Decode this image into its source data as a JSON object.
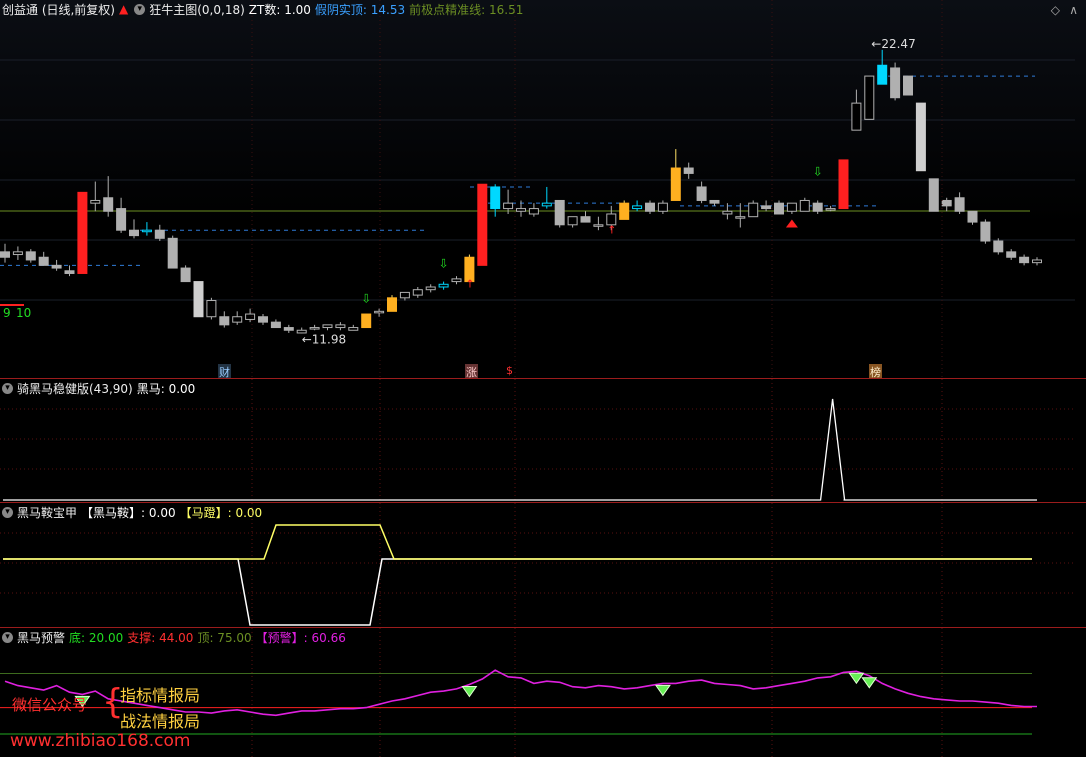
{
  "main_header": {
    "title": "创益通 (日线,前复权)",
    "indicator": "狂牛主图(0,0,18)",
    "zt_label": "ZT数: 1.00",
    "fake_label": "假阴实顶: 14.53",
    "prev_label": "前极点精准线: 16.51"
  },
  "main_annotations": {
    "high_label": "22.47",
    "low_label": "11.98",
    "count_a": "9",
    "count_b": "10",
    "tag_cai": "财",
    "tag_zhang": "涨",
    "tag_s": "$",
    "tag_bang": "榜"
  },
  "panel2_header": {
    "title": "骑黑马稳健版(43,90)",
    "value_label": "黑马: 0.00"
  },
  "panel3_header": {
    "title": "黑马鞍宝甲",
    "a_label": "【黑马鞍】: 0.00",
    "b_label": "【马蹬】: 0.00"
  },
  "panel4_header": {
    "title": "黑马预警",
    "d_label": "底: 20.00",
    "s_label": "支撑: 44.00",
    "t_label": "顶: 75.00",
    "w_label": "【预警】: 60.66"
  },
  "watermark": {
    "left": "微信公众号",
    "line1": "指标情报局",
    "line2": "战法情报局",
    "url": "www.zhibiao168.com"
  },
  "colors": {
    "up": "#ff2020",
    "down": "#00d8ff",
    "line_white": "#ffffff",
    "line_yellow": "#ffff66",
    "line_magenta": "#e020e0",
    "baseline_olive": "#6b8e23"
  },
  "chart_data": {
    "type": "candlestick",
    "ylim": [
      11.0,
      23.5
    ],
    "candles": [
      [
        15.0,
        15.3,
        14.6,
        14.8,
        "g"
      ],
      [
        14.9,
        15.2,
        14.7,
        15.0,
        "g"
      ],
      [
        15.0,
        15.1,
        14.6,
        14.7,
        "g"
      ],
      [
        14.8,
        15.0,
        14.5,
        14.5,
        "g"
      ],
      [
        14.5,
        14.7,
        14.3,
        14.4,
        "g"
      ],
      [
        14.3,
        14.5,
        14.1,
        14.2,
        "g"
      ],
      [
        14.2,
        17.2,
        14.2,
        17.2,
        "r"
      ],
      [
        16.8,
        17.6,
        16.5,
        16.9,
        "g"
      ],
      [
        17.0,
        17.8,
        16.3,
        16.5,
        "g"
      ],
      [
        16.6,
        17.0,
        15.7,
        15.8,
        "g"
      ],
      [
        15.8,
        16.2,
        15.5,
        15.6,
        "g"
      ],
      [
        15.8,
        16.1,
        15.6,
        15.8,
        "b"
      ],
      [
        15.8,
        16.0,
        15.4,
        15.5,
        "g"
      ],
      [
        15.5,
        15.6,
        14.4,
        14.4,
        "g"
      ],
      [
        14.4,
        14.5,
        13.9,
        13.9,
        "g"
      ],
      [
        13.9,
        13.9,
        12.6,
        12.6,
        "gg"
      ],
      [
        12.6,
        13.3,
        12.5,
        13.2,
        "g"
      ],
      [
        12.6,
        12.8,
        12.2,
        12.3,
        "g"
      ],
      [
        12.4,
        12.8,
        12.3,
        12.6,
        "g"
      ],
      [
        12.5,
        12.9,
        12.4,
        12.7,
        "g"
      ],
      [
        12.6,
        12.7,
        12.3,
        12.4,
        "g"
      ],
      [
        12.4,
        12.5,
        12.2,
        12.2,
        "g"
      ],
      [
        12.2,
        12.3,
        12.0,
        12.1,
        "g"
      ],
      [
        12.0,
        12.2,
        11.98,
        12.1,
        "g"
      ],
      [
        12.2,
        12.3,
        12.1,
        12.2,
        "g"
      ],
      [
        12.2,
        12.3,
        12.1,
        12.3,
        "g"
      ],
      [
        12.2,
        12.4,
        12.1,
        12.3,
        "g"
      ],
      [
        12.1,
        12.3,
        12.1,
        12.2,
        "g"
      ],
      [
        12.2,
        12.7,
        12.2,
        12.7,
        "o"
      ],
      [
        12.8,
        12.9,
        12.6,
        12.8,
        "g"
      ],
      [
        12.8,
        13.4,
        12.8,
        13.3,
        "o"
      ],
      [
        13.3,
        13.5,
        13.2,
        13.5,
        "g"
      ],
      [
        13.4,
        13.7,
        13.3,
        13.6,
        "g"
      ],
      [
        13.6,
        13.8,
        13.5,
        13.7,
        "g"
      ],
      [
        13.7,
        13.9,
        13.6,
        13.8,
        "b"
      ],
      [
        13.9,
        14.1,
        13.8,
        14.0,
        "g"
      ],
      [
        13.9,
        14.9,
        13.9,
        14.8,
        "o"
      ],
      [
        14.5,
        17.5,
        14.5,
        17.5,
        "r"
      ],
      [
        17.4,
        17.5,
        16.3,
        16.6,
        "bb"
      ],
      [
        16.6,
        17.3,
        16.4,
        16.8,
        "g"
      ],
      [
        16.5,
        16.9,
        16.3,
        16.6,
        "g"
      ],
      [
        16.4,
        16.8,
        16.3,
        16.6,
        "g"
      ],
      [
        16.7,
        17.4,
        16.6,
        16.8,
        "b"
      ],
      [
        16.9,
        16.9,
        15.9,
        16.0,
        "g"
      ],
      [
        16.0,
        16.3,
        15.9,
        16.3,
        "g"
      ],
      [
        16.3,
        16.5,
        16.1,
        16.1,
        "g"
      ],
      [
        16.0,
        16.3,
        15.8,
        16.0,
        "g"
      ],
      [
        16.0,
        16.7,
        15.8,
        16.4,
        "g"
      ],
      [
        16.2,
        16.9,
        16.2,
        16.8,
        "o"
      ],
      [
        16.6,
        16.9,
        16.5,
        16.7,
        "b"
      ],
      [
        16.8,
        16.9,
        16.4,
        16.5,
        "g"
      ],
      [
        16.5,
        16.9,
        16.4,
        16.8,
        "g"
      ],
      [
        16.9,
        18.8,
        16.9,
        18.1,
        "o"
      ],
      [
        18.1,
        18.3,
        17.7,
        17.9,
        "g"
      ],
      [
        17.4,
        17.6,
        16.8,
        16.9,
        "g"
      ],
      [
        16.9,
        16.9,
        16.7,
        16.8,
        "g"
      ],
      [
        16.4,
        16.8,
        16.2,
        16.5,
        "g"
      ],
      [
        16.3,
        16.8,
        15.9,
        16.3,
        "g"
      ],
      [
        16.3,
        16.9,
        16.3,
        16.8,
        "g"
      ],
      [
        16.7,
        16.9,
        16.5,
        16.6,
        "g"
      ],
      [
        16.8,
        16.9,
        16.4,
        16.4,
        "g"
      ],
      [
        16.5,
        16.8,
        16.4,
        16.8,
        "g"
      ],
      [
        16.5,
        17.0,
        16.5,
        16.9,
        "g"
      ],
      [
        16.8,
        16.9,
        16.4,
        16.5,
        "g"
      ],
      [
        16.6,
        16.7,
        16.5,
        16.6,
        "g"
      ],
      [
        16.6,
        18.4,
        16.6,
        18.4,
        "r"
      ],
      [
        19.5,
        21.0,
        19.5,
        20.5,
        "g"
      ],
      [
        19.9,
        21.2,
        19.9,
        21.5,
        "g"
      ],
      [
        21.2,
        22.47,
        21.2,
        21.9,
        "bb"
      ],
      [
        21.8,
        22.0,
        20.6,
        20.7,
        "g"
      ],
      [
        21.5,
        21.5,
        20.8,
        20.8,
        "g"
      ],
      [
        20.5,
        20.5,
        18.0,
        18.0,
        "gg"
      ],
      [
        17.7,
        17.7,
        16.5,
        16.5,
        "g"
      ],
      [
        16.9,
        17.0,
        16.5,
        16.7,
        "g"
      ],
      [
        17.0,
        17.2,
        16.4,
        16.5,
        "g"
      ],
      [
        16.5,
        16.5,
        16.0,
        16.1,
        "g"
      ],
      [
        16.1,
        16.2,
        15.3,
        15.4,
        "g"
      ],
      [
        15.4,
        15.5,
        14.9,
        15.0,
        "g"
      ],
      [
        15.0,
        15.1,
        14.7,
        14.8,
        "g"
      ],
      [
        14.8,
        14.9,
        14.5,
        14.6,
        "g"
      ],
      [
        14.6,
        14.8,
        14.5,
        14.7,
        "g"
      ]
    ],
    "panel2_values": [
      0,
      0,
      0,
      0,
      0,
      0,
      0,
      0,
      0,
      0,
      0,
      0,
      0,
      0,
      0,
      0,
      0,
      0,
      0,
      0,
      0,
      0,
      0,
      0,
      0,
      0,
      0,
      0,
      0,
      0,
      0,
      0,
      0,
      0,
      0,
      0,
      0,
      0,
      0,
      0,
      0,
      0,
      0,
      0,
      0,
      0,
      0,
      0,
      0,
      0,
      0,
      0,
      0,
      0,
      0,
      0,
      0,
      0,
      0,
      0,
      0,
      0,
      0,
      0,
      1,
      0,
      0,
      0,
      0,
      0,
      0,
      0,
      0,
      0,
      0,
      0,
      0,
      0,
      0,
      0,
      0
    ],
    "panel4_values": [
      68,
      64,
      62,
      60,
      64,
      58,
      56,
      59,
      52,
      50,
      48,
      46,
      44,
      42,
      40,
      40,
      39,
      41,
      42,
      40,
      38,
      37,
      39,
      41,
      41,
      42,
      43,
      43,
      44,
      47,
      50,
      52,
      55,
      58,
      59,
      61,
      65,
      70,
      78,
      72,
      71,
      66,
      68,
      67,
      63,
      62,
      64,
      63,
      61,
      62,
      64,
      66,
      66,
      68,
      69,
      66,
      65,
      64,
      61,
      62,
      64,
      66,
      68,
      71,
      72,
      76,
      77,
      73,
      66,
      61,
      57,
      54,
      52,
      51,
      50,
      50,
      49,
      48,
      46,
      45,
      45
    ],
    "panel4_levels": {
      "bottom": 20,
      "support": 44,
      "top": 75
    }
  }
}
